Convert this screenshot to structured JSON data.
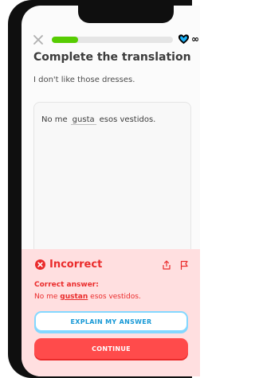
{
  "header": {
    "progress_fraction": 0.22,
    "hearts_count": "∞"
  },
  "challenge": {
    "title": "Complete the translation",
    "prompt": "I don't like those dresses.",
    "sentence_before": "No me",
    "sentence_blank": "gusta",
    "sentence_after": "esos vestidos."
  },
  "feedback": {
    "status": "Incorrect",
    "correct_label": "Correct answer:",
    "correct_before": "No me",
    "correct_highlight": "gustan",
    "correct_after": "esos vestidos.",
    "explain_label": "EXPLAIN MY ANSWER",
    "continue_label": "CONTINUE"
  },
  "colors": {
    "accent_green": "#57cc02",
    "error_red": "#ea2b2b",
    "panel_bg": "#ffdfe0",
    "link_blue": "#1899d6"
  }
}
